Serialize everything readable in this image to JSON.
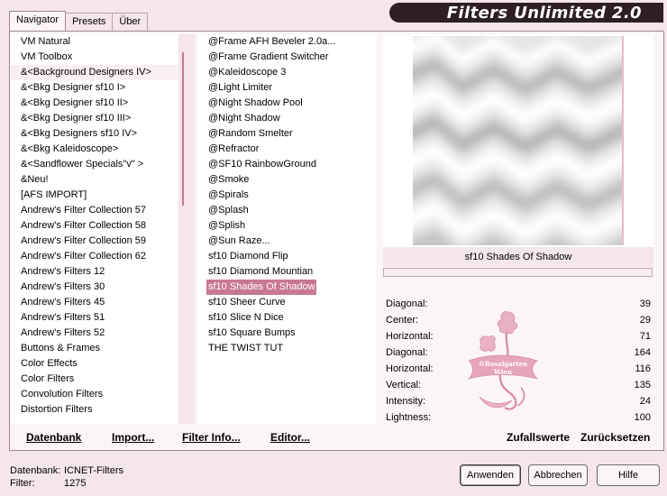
{
  "tabs": [
    "Navigator",
    "Presets",
    "Über"
  ],
  "app_title": "Filters Unlimited 2.0",
  "categories": [
    "VM Natural",
    "VM Toolbox",
    "&<Background Designers IV>",
    "&<Bkg Designer sf10 I>",
    "&<Bkg Designer sf10 II>",
    "&<Bkg Designer sf10 III>",
    "&<Bkg Designers sf10 IV>",
    "&<Bkg Kaleidoscope>",
    "&<Sandflower Specials\"v\" >",
    "&Neu!",
    "[AFS IMPORT]",
    "Andrew's Filter Collection 57",
    "Andrew's Filter Collection 58",
    "Andrew's Filter Collection 59",
    "Andrew's Filter Collection 62",
    "Andrew's Filters 12",
    "Andrew's Filters 30",
    "Andrew's Filters 45",
    "Andrew's Filters 51",
    "Andrew's Filters 52",
    "Buttons & Frames",
    "Color Effects",
    "Color Filters",
    "Convolution Filters",
    "Distortion Filters"
  ],
  "selected_category_index": 2,
  "filters": [
    "@Frame AFH Beveler 2.0a...",
    "@Frame Gradient Switcher",
    "@Kaleidoscope 3",
    "@Light Limiter",
    "@Night Shadow Pool",
    "@Night Shadow",
    "@Random Smelter",
    "@Refractor",
    "@SF10 RainbowGround",
    "@Smoke",
    "@Spirals",
    "@Splash",
    "@Splish",
    "@Sun Raze...",
    "sf10 Diamond Flip",
    "sf10 Diamond Mountian",
    "sf10 Shades Of Shadow",
    "sf10 Sheer Curve",
    "sf10 Slice N Dice",
    "sf10 Square Bumps",
    "THE TWIST TUT"
  ],
  "selected_filter_index": 16,
  "current_filter_name": "sf10 Shades Of Shadow",
  "params": [
    {
      "label": "Diagonal:",
      "value": "39"
    },
    {
      "label": "Center:",
      "value": "29"
    },
    {
      "label": "Horizontal:",
      "value": "71"
    },
    {
      "label": "Diagonal:",
      "value": "164"
    },
    {
      "label": "Horizontal:",
      "value": "116"
    },
    {
      "label": "Vertical:",
      "value": "135"
    },
    {
      "label": "Intensity:",
      "value": "24"
    },
    {
      "label": "Lightness:",
      "value": "100"
    }
  ],
  "watermark_text": [
    "©Rosalgarten",
    "Wien"
  ],
  "links": {
    "database": "Datenbank",
    "import": "Import...",
    "filter_info": "Filter Info...",
    "editor": "Editor...",
    "random": "Zufallswerte",
    "reset": "Zurücksetzen"
  },
  "status": {
    "database_label": "Datenbank:",
    "database_value": "ICNET-Filters",
    "filter_label": "Filter:",
    "filter_value": "1275"
  },
  "buttons": {
    "apply": "Anwenden",
    "cancel": "Abbrechen",
    "help": "Hilfe"
  },
  "colors": {
    "accent": "#c87892",
    "background": "#f4e6ea",
    "banner": "#2d1f22"
  }
}
